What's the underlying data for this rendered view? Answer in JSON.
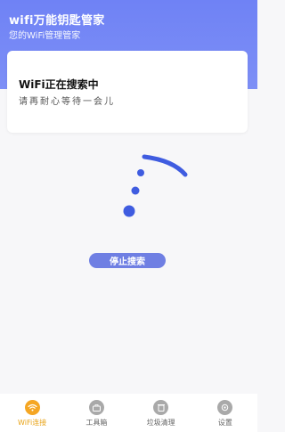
{
  "header": {
    "title": "wifi万能钥匙管家",
    "subtitle": "您的WiFi管理管家"
  },
  "card": {
    "title": "WiFi正在搜索中",
    "description": "请再耐心等待一会儿"
  },
  "actions": {
    "stop_label": "停止搜索"
  },
  "tabbar": {
    "items": [
      {
        "label": "WiFi连接",
        "icon": "wifi-icon",
        "active": true
      },
      {
        "label": "工具箱",
        "icon": "toolbox-icon",
        "active": false
      },
      {
        "label": "垃圾清理",
        "icon": "trash-icon",
        "active": false
      },
      {
        "label": "设置",
        "icon": "settings-icon",
        "active": false
      }
    ]
  },
  "colors": {
    "header": "#6f82f5",
    "accent": "#3f5ce0",
    "button": "#6f7fe3",
    "active_tab": "#e8a317",
    "inactive_tab": "#9a9a9a"
  }
}
